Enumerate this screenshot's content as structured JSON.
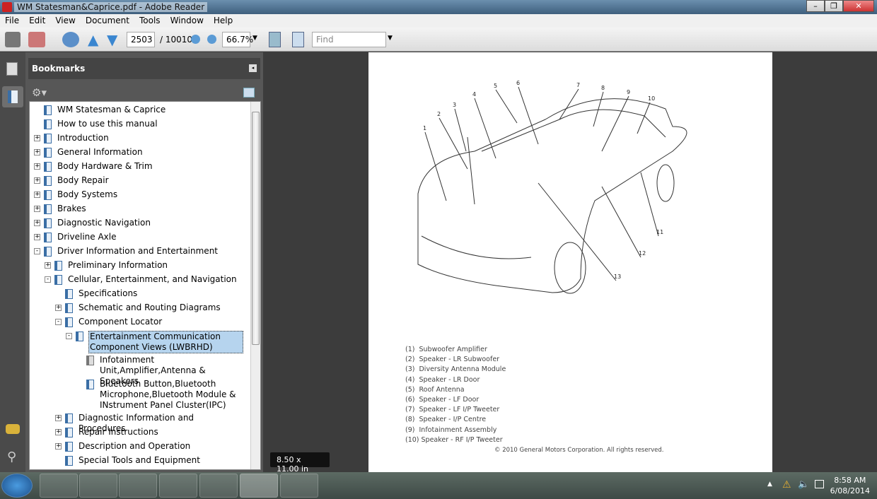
{
  "window": {
    "title": "WM Statesman&Caprice.pdf - Adobe Reader"
  },
  "menu": [
    "File",
    "Edit",
    "View",
    "Document",
    "Tools",
    "Window",
    "Help"
  ],
  "toolbar": {
    "page_current": "2503",
    "page_total": "/ 10010",
    "zoom": "66.7%",
    "find_placeholder": "Find"
  },
  "bookmarks": {
    "title": "Bookmarks",
    "items": [
      {
        "label": "WM Statesman & Caprice",
        "level": 0,
        "expander": "",
        "icon": "bookmark"
      },
      {
        "label": "How to use this manual",
        "level": 0,
        "expander": "",
        "icon": "bookmark"
      },
      {
        "label": "Introduction",
        "level": 0,
        "expander": "+",
        "icon": "bookmark"
      },
      {
        "label": "General Information",
        "level": 0,
        "expander": "+",
        "icon": "bookmark"
      },
      {
        "label": "Body Hardware & Trim",
        "level": 0,
        "expander": "+",
        "icon": "bookmark"
      },
      {
        "label": "Body Repair",
        "level": 0,
        "expander": "+",
        "icon": "bookmark"
      },
      {
        "label": "Body Systems",
        "level": 0,
        "expander": "+",
        "icon": "bookmark"
      },
      {
        "label": "Brakes",
        "level": 0,
        "expander": "+",
        "icon": "bookmark"
      },
      {
        "label": "Diagnostic Navigation",
        "level": 0,
        "expander": "+",
        "icon": "bookmark"
      },
      {
        "label": "Driveline Axle",
        "level": 0,
        "expander": "+",
        "icon": "bookmark"
      },
      {
        "label": "Driver Information and Entertainment",
        "level": 0,
        "expander": "-",
        "icon": "bookmark"
      },
      {
        "label": "Preliminary Information",
        "level": 1,
        "expander": "+",
        "icon": "bookmark"
      },
      {
        "label": "Cellular, Entertainment, and Navigation",
        "level": 1,
        "expander": "-",
        "icon": "bookmark"
      },
      {
        "label": "Specifications",
        "level": 2,
        "expander": "",
        "icon": "bookmark"
      },
      {
        "label": "Schematic and Routing Diagrams",
        "level": 2,
        "expander": "+",
        "icon": "bookmark"
      },
      {
        "label": "Component Locator",
        "level": 2,
        "expander": "-",
        "icon": "bookmark"
      },
      {
        "label": "Entertainment Communication Component Views (LWBRHD)",
        "level": 3,
        "expander": "-",
        "icon": "bookmark",
        "selected": true,
        "lines": 2
      },
      {
        "label": "Infotainment Unit,Amplifier,Antenna & Speakers",
        "level": 4,
        "expander": "",
        "icon": "bookmark-gray",
        "lines": 2
      },
      {
        "label": "Bluetooth Button,Bluetooth Microphone,Bluetooth Module & INstrument Panel Cluster(IPC)",
        "level": 4,
        "expander": "",
        "icon": "bookmark",
        "lines": 3
      },
      {
        "label": "Diagnostic Information and Procedures",
        "level": 2,
        "expander": "+",
        "icon": "bookmark"
      },
      {
        "label": "Repair Instructions",
        "level": 2,
        "expander": "+",
        "icon": "bookmark"
      },
      {
        "label": "Description and Operation",
        "level": 2,
        "expander": "+",
        "icon": "bookmark"
      },
      {
        "label": "Special Tools and Equipment",
        "level": 2,
        "expander": "",
        "icon": "bookmark"
      }
    ]
  },
  "document": {
    "callouts": [
      "1",
      "2",
      "3",
      "4",
      "5",
      "6",
      "7",
      "8",
      "9",
      "10",
      "11",
      "12",
      "13"
    ],
    "legend": [
      "(1)  Subwoofer Amplifier",
      "(2)  Speaker - LR Subwoofer",
      "(3)  Diversity Antenna Module",
      "(4)  Speaker - LR Door",
      "(5)  Roof Antenna",
      "(6)  Speaker - LF Door",
      "(7)  Speaker - LF I/P Tweeter",
      "(8)  Speaker - I/P Centre",
      "(9)  Infotainment Assembly",
      "(10) Speaker - RF I/P Tweeter"
    ],
    "copyright": "© 2010 General Motors Corporation.  All rights reserved.",
    "page_size": "8.50 x 11.00 in"
  },
  "taskbar": {
    "time": "8:58 AM",
    "date": "6/08/2014"
  },
  "colors": {
    "selection": "#b6d4ee",
    "panel": "#575757",
    "workspace": "#3c3c3c"
  }
}
